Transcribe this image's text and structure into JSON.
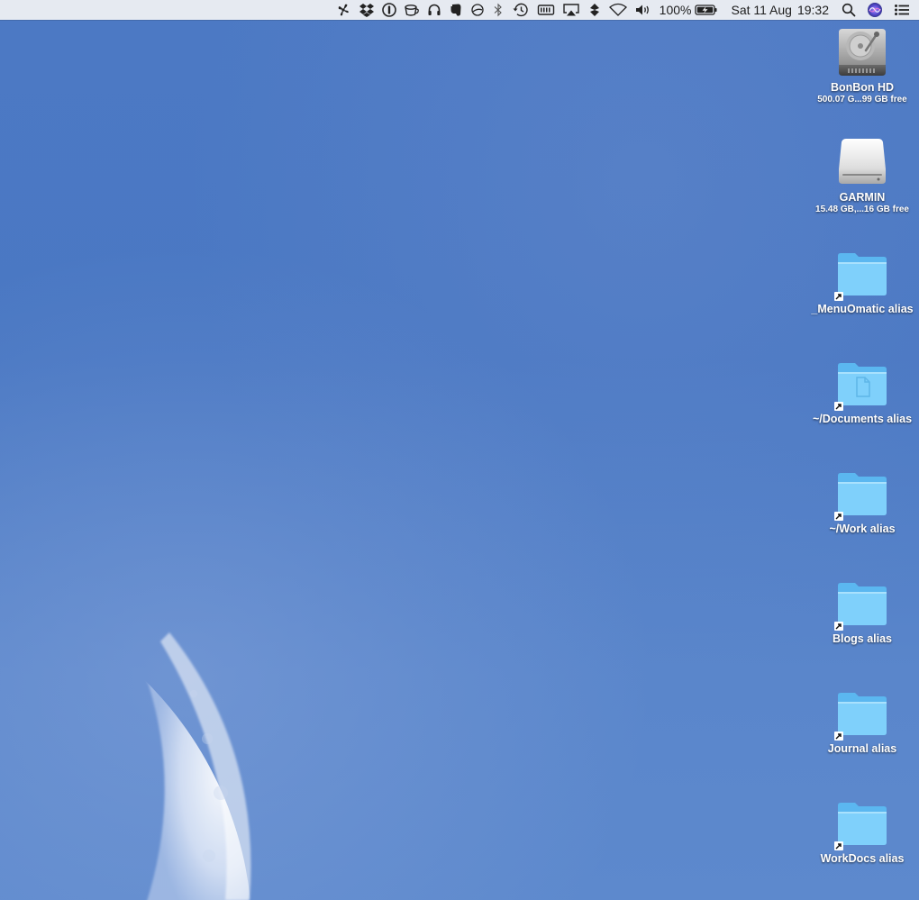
{
  "menubar": {
    "status_icons": [
      "fan-icon",
      "dropbox-icon",
      "1password-icon",
      "coffee-cup-icon",
      "headphones-icon",
      "evernote-icon",
      "circle-slash-icon",
      "bluetooth-icon",
      "time-machine-icon",
      "keyboard-icon",
      "airplay-icon",
      "diamond-app-icon",
      "wifi-icon",
      "volume-icon"
    ],
    "battery_percent": "100%",
    "date": "Sat 11 Aug",
    "time": "19:32",
    "right_icons": [
      "spotlight-search-icon",
      "siri-icon",
      "notification-center-icon"
    ]
  },
  "desktop": {
    "items": [
      {
        "name": "BonBon HD",
        "info": "500.07 G...99 GB free",
        "kind": "hard-drive"
      },
      {
        "name": "GARMIN",
        "info": "15.48 GB,...16 GB free",
        "kind": "external-drive"
      },
      {
        "name": "_MenuOmatic alias",
        "kind": "folder-alias"
      },
      {
        "name": "~/Documents alias",
        "kind": "documents-folder-alias"
      },
      {
        "name": "~/Work alias",
        "kind": "folder-alias"
      },
      {
        "name": "Blogs alias",
        "kind": "folder-alias"
      },
      {
        "name": "Journal alias",
        "kind": "folder-alias"
      },
      {
        "name": "WorkDocs alias",
        "kind": "folder-alias"
      }
    ]
  },
  "colors": {
    "desktop_blue": "#4c79c4",
    "menubar_bg": "#eceef2",
    "folder_blue": "#7fd0fb",
    "folder_blue_dark": "#5bb7f0"
  }
}
